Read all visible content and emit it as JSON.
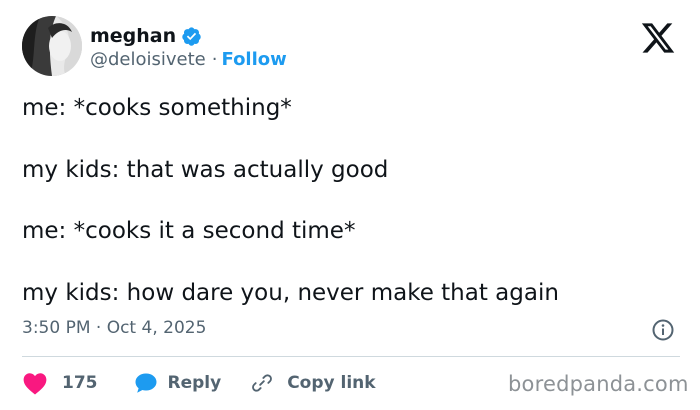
{
  "author": {
    "display_name": "meghan",
    "handle": "@deloisivete",
    "separator": "·",
    "follow_label": "Follow",
    "verified": true
  },
  "tweet": {
    "lines": [
      "me: *cooks something*",
      "my kids: that was actually good",
      "me: *cooks it a second time*",
      "my kids: how dare you, never make that again"
    ],
    "timestamp": "3:50 PM · Oct 4, 2025"
  },
  "actions": {
    "like_count": "175",
    "reply_label": "Reply",
    "copy_label": "Copy link"
  },
  "watermark": "boredpanda.com",
  "colors": {
    "accent": "#1d9bf0",
    "like": "#f91880",
    "muted_text": "#536471",
    "divider": "#cfd9de",
    "text": "#0f1419"
  },
  "icons": [
    "verified-badge-icon",
    "x-logo-icon",
    "info-icon",
    "heart-icon",
    "reply-bubble-icon",
    "link-icon"
  ]
}
